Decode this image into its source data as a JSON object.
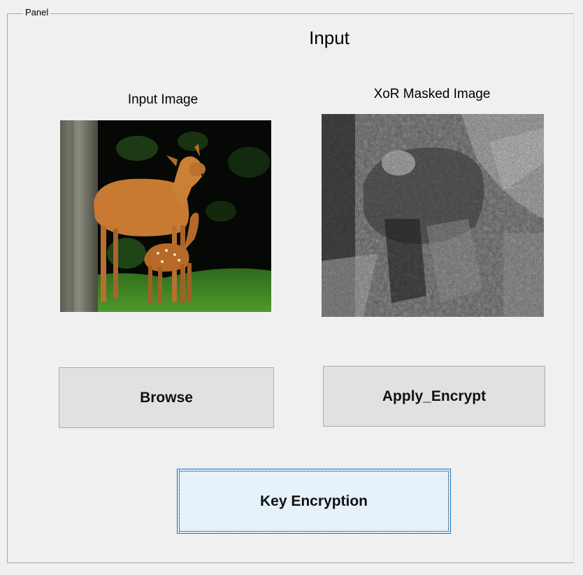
{
  "panel": {
    "title": "Panel",
    "heading": "Input"
  },
  "images": {
    "input_label": "Input Image",
    "masked_label": "XoR Masked Image"
  },
  "buttons": {
    "browse": "Browse",
    "apply_encrypt": "Apply_Encrypt",
    "key_encryption": "Key Encryption"
  },
  "colors": {
    "window_bg": "#f0f0f0",
    "button_bg": "#e1e1e1",
    "focused_button_bg": "#e5f1fb",
    "focus_border": "#0078d7"
  }
}
